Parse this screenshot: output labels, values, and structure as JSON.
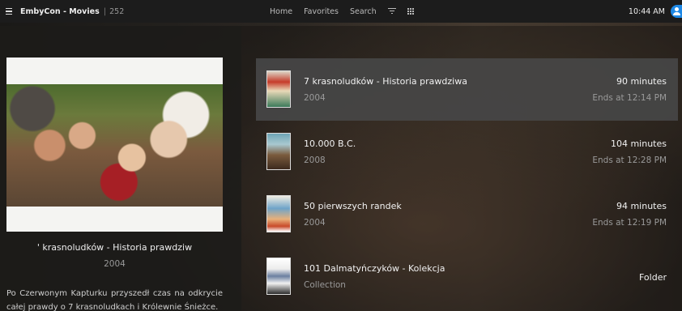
{
  "header": {
    "app_title": "EmbyCon - Movies",
    "separator": "|",
    "count": "252",
    "nav": [
      "Home",
      "Favorites",
      "Search"
    ],
    "clock": "10:44 AM"
  },
  "details": {
    "title": "' krasnoludków - Historia prawdziw",
    "year": "2004",
    "overview": "Po Czerwonym Kapturku przyszedł czas na odkrycie całej prawdy o 7 krasnoludkach i Królewnie Śnieżce."
  },
  "items": [
    {
      "title": "7 krasnoludków - Historia prawdziwa",
      "sub": "2004",
      "runtime": "90 minutes",
      "ends": "Ends at 12:14 PM"
    },
    {
      "title": "10.000 B.C.",
      "sub": "2008",
      "runtime": "104 minutes",
      "ends": "Ends at 12:28 PM"
    },
    {
      "title": "50 pierwszych randek",
      "sub": "2004",
      "runtime": "94 minutes",
      "ends": "Ends at 12:19 PM"
    },
    {
      "title": "101 Dalmatyńczyków - Kolekcja",
      "sub": "Collection",
      "folder": "Folder"
    }
  ],
  "colors": {
    "accent": "#1e88e5",
    "selected_row": "#464646"
  }
}
